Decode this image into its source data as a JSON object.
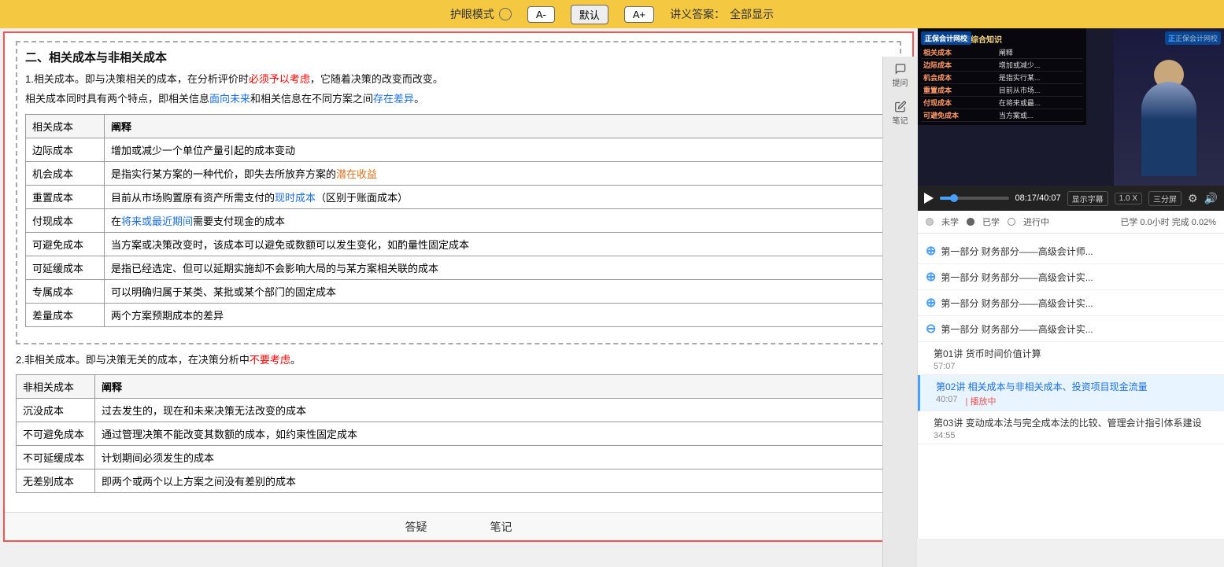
{
  "topbar": {
    "eye_mode_label": "护眼模式",
    "font_small": "A-",
    "font_default": "默认",
    "font_large": "A+",
    "lecture_answer": "讲义答案：",
    "show_all": "全部显示"
  },
  "content": {
    "section_title": "二、相关成本与非相关成本",
    "related_cost_intro": "1.相关成本。即与决策相关的成本，在分析评价时",
    "related_cost_must": "必须予以考虑",
    "related_cost_mid": "，它随着决策的改变而改变。",
    "related_cost_sub_intro": "相关成本同时具有两个特点，即相关信息",
    "related_cost_blue1": "面向未来",
    "related_cost_sub_mid": "和相关信息在不同方案之间",
    "related_cost_blue2": "存在差异",
    "related_cost_sub_end": "。",
    "table1_col1": "相关成本",
    "table1_col2": "阐释",
    "related_rows": [
      {
        "name": "边际成本",
        "desc": "增加或减少一个单位产量引起的成本变动"
      },
      {
        "name": "机会成本",
        "desc_pre": "是指实行某方案的一种代价，即失去所放弃方案的",
        "desc_highlight": "潜在收益",
        "desc_post": ""
      },
      {
        "name": "重置成本",
        "desc_pre": "目前从市场购置原有资产所需支付的",
        "desc_highlight": "现时成本",
        "desc_post": "（区别于账面成本）"
      },
      {
        "name": "付现成本",
        "desc_pre": "在",
        "desc_highlight": "将来或最近期间",
        "desc_post": "需要支付现金的成本"
      },
      {
        "name": "可避免成本",
        "desc": "当方案或决策改变时，该成本可以避免或数额可以发生变化，如酌量性固定成本"
      },
      {
        "name": "可延缓成本",
        "desc": "是指已经选定、但可以延期实施却不会影响大局的与某方案相关联的成本"
      },
      {
        "name": "专属成本",
        "desc": "可以明确归属于某类、某批或某个部门的固定成本"
      },
      {
        "name": "差量成本",
        "desc": "两个方案预期成本的差异"
      }
    ],
    "unrelated_intro_pre": "2.非相关成本。即与决策无关的成本，在决策分析中",
    "unrelated_intro_highlight": "不要考虑",
    "unrelated_intro_post": "。",
    "table2_col1": "非相关成本",
    "table2_col2": "阐释",
    "unrelated_rows": [
      {
        "name": "沉没成本",
        "desc": "过去发生的，现在和未来决策无法改变的成本"
      },
      {
        "name": "不可避免成本",
        "desc": "通过管理决策不能改变其数额的成本，如约束性固定成本"
      },
      {
        "name": "不可延缓成本",
        "desc": "计划期间必须发生的成本"
      },
      {
        "name": "无差别成本",
        "desc": "即两个或两个以上方案之间没有差别的成本"
      }
    ]
  },
  "bottom_tabs": {
    "qa": "答疑",
    "notes": "笔记"
  },
  "right_icons": {
    "ask": "提问",
    "notes": "笔记"
  },
  "video": {
    "time_current": "08:17",
    "time_total": "40:07",
    "subtitle_btn": "显示字幕",
    "speed_btn": "1.0 X",
    "layout_btn": "三分屏",
    "watermark": "正保会计网校",
    "overlay_title": "高级会计务管综合知识",
    "overlay_rows": [
      {
        "key": "相关成本",
        "val": "阐释"
      },
      {
        "key": "边际成本",
        "val": "增加或减少一个单位产量引起的成本变动"
      },
      {
        "key": "机会成本",
        "val": "是指实行某方案的..."
      },
      {
        "key": "重置成本",
        "val": "目前从市场购置..."
      },
      {
        "key": "付现成本",
        "val": "在将来或最近..."
      },
      {
        "key": "可避免成本",
        "val": "当方案或..."
      }
    ]
  },
  "status": {
    "not_learned": "未学",
    "learned": "已学",
    "in_progress": "进行中",
    "completed_pre": "已学",
    "completed_hours": "0.0小时",
    "completed_post": "完成 0.02%"
  },
  "course_sections": [
    {
      "type": "expand",
      "title": "第一部分  财务部分——高级会计师...",
      "expanded": false
    },
    {
      "type": "expand",
      "title": "第一部分  财务部分——高级会计实...",
      "expanded": false
    },
    {
      "type": "expand",
      "title": "第一部分  财务部分——高级会计实...",
      "expanded": false
    },
    {
      "type": "collapse",
      "title": "第一部分  财务部分——高级会计实...",
      "expanded": true
    }
  ],
  "course_items": [
    {
      "id": "01",
      "title": "第01讲  货币时间价值计算",
      "duration": "57:07",
      "active": false,
      "playing": false
    },
    {
      "id": "02",
      "title": "第02讲  相关成本与非相关成本、投资项目现金流量",
      "duration": "40:07",
      "active": true,
      "playing": true,
      "playing_label": "播放中"
    },
    {
      "id": "03",
      "title": "第03讲  变动成本法与完全成本法的比较、管理会计指引体系建设",
      "duration": "34:55",
      "active": false,
      "playing": false
    }
  ]
}
